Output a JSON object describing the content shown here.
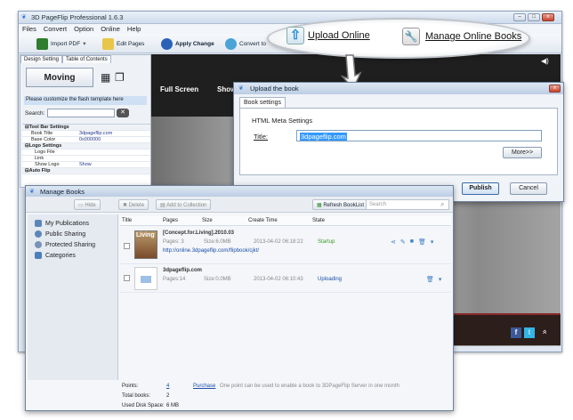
{
  "main_window": {
    "title": "3D PageFlip Professional 1.6.3",
    "menu": [
      "Files",
      "Convert",
      "Option",
      "Online",
      "Help"
    ],
    "toolbar": {
      "import_pdf": "Import PDF",
      "edit_pages": "Edit Pages",
      "apply_change": "Apply Change",
      "convert_to": "Convert to"
    },
    "window_buttons": {
      "minimize": "–",
      "maximize": "□",
      "close": "x"
    }
  },
  "left_panel": {
    "tabs": [
      "Design Setting",
      "Table of Contents"
    ],
    "template_name": "Moving",
    "customize_note": "Please customize the flash template here",
    "search_label": "Search:",
    "properties": [
      {
        "key": "⊟Tool Bar Settings",
        "value": "",
        "header": true
      },
      {
        "key": "Book Title",
        "value": "3dpageflip.com"
      },
      {
        "key": "Base Color",
        "value": "0x000000"
      },
      {
        "key": "⊟Logo Settings",
        "value": "",
        "header": true
      },
      {
        "key": "Logo File",
        "value": ""
      },
      {
        "key": "Link",
        "value": ""
      },
      {
        "key": "Show Logo",
        "value": "Show"
      },
      {
        "key": "⊟Auto Flip",
        "value": "",
        "header": true
      }
    ]
  },
  "preview": {
    "full_screen": "Full Screen",
    "show": "Show",
    "fb": "f",
    "tw": "t",
    "up": "»"
  },
  "callout": {
    "upload_online": "Upload Online",
    "manage_online_books": "Manage Online Books"
  },
  "upload_dialog": {
    "title": "Upload the book",
    "tab": "Book settings",
    "section": "HTML Meta Settings",
    "title_label": "Title:",
    "title_value": "3dpageflip.com",
    "more_button": "More>>",
    "publish_button": "Publish",
    "cancel_button": "Cancel"
  },
  "manage_books": {
    "title": "Manage Books",
    "toolbar": {
      "hide": "Hide",
      "delete": "Delete",
      "add_to_collection": "Add to Collection",
      "refresh": "Refresh BookList",
      "search_placeholder": "Search"
    },
    "sidebar": [
      "My Publications",
      "Public Sharing",
      "Protected Sharing",
      "Categories"
    ],
    "columns": {
      "title": "Title",
      "pages": "Pages",
      "size": "Size",
      "create_time": "Create Time",
      "state": "State"
    },
    "books": [
      {
        "title": "[Concept.for.Living].2010.03",
        "pages": "Pages: 3",
        "size": "Size:6.0MB",
        "time": "2013-04-02 06:18:22",
        "state": "Startup",
        "url": "http://online.3dpageflip.com/flipbook/cjkt/",
        "cover": "Living"
      },
      {
        "title": "3dpageflip.com",
        "pages": "Pages:14",
        "size": "Size:0.0MB",
        "time": "2013-04-02 06:10:43",
        "state": "Uploading",
        "url": ""
      }
    ],
    "footer": {
      "points_label": "Points:",
      "points_value": "4",
      "purchase": "Purchase",
      "points_note": "One point can be used to enable a book to 3DPageFlip Server in one month",
      "total_label": "Total books:",
      "total_value": "2",
      "disk_label": "Used Disk Space:",
      "disk_value": "6 MB"
    }
  },
  "colors": {
    "accent": "#3f7fc4",
    "state_green": "#3a9a2b",
    "link": "#1c4fa8",
    "selection": "#3399ff"
  }
}
